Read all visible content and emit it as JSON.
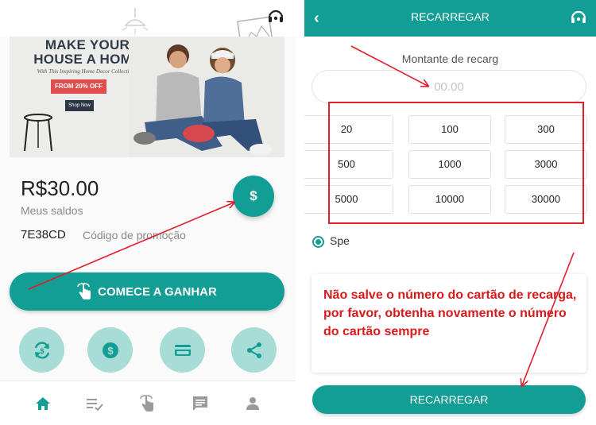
{
  "left_screen": {
    "banner": {
      "headline": "MAKE YOUR HOUSE A HOME",
      "subtitle": "With This Inspiring Home Decor Collection",
      "offer": "FROM 20% OFF",
      "cta": "Shop Now"
    },
    "balance": {
      "amount": "R$30.00",
      "label": "Meus saldos"
    },
    "promo": {
      "code": "7E38CD",
      "label": "Código de promoção"
    },
    "earn_button_label": "COMECE A GANHAR",
    "quick_actions": [
      "exchange-icon",
      "dollar-icon",
      "card-icon",
      "share-icon"
    ],
    "bottom_nav": {
      "items": [
        "home-icon",
        "list-icon",
        "tap-icon",
        "chat-icon",
        "profile-icon"
      ],
      "active_index": 0
    }
  },
  "right_screen": {
    "header": {
      "title": "RECARREGAR"
    },
    "amount_label": "Montante de recarg",
    "amount_input_placeholder": "00.00",
    "preset_amounts": [
      "20",
      "100",
      "300",
      "500",
      "1000",
      "3000",
      "5000",
      "10000",
      "30000"
    ],
    "payment_option_label": "Spe",
    "warning": "Não salve o número do cartão de recarga, por favor, obtenha novamente o número do cartão sempre",
    "submit_label": "RECARREGAR"
  },
  "colors": {
    "primary": "#139e95",
    "primary_light": "#a8ddd7",
    "annotation_red": "#e11d2a",
    "warning_text": "#d71a1a"
  }
}
